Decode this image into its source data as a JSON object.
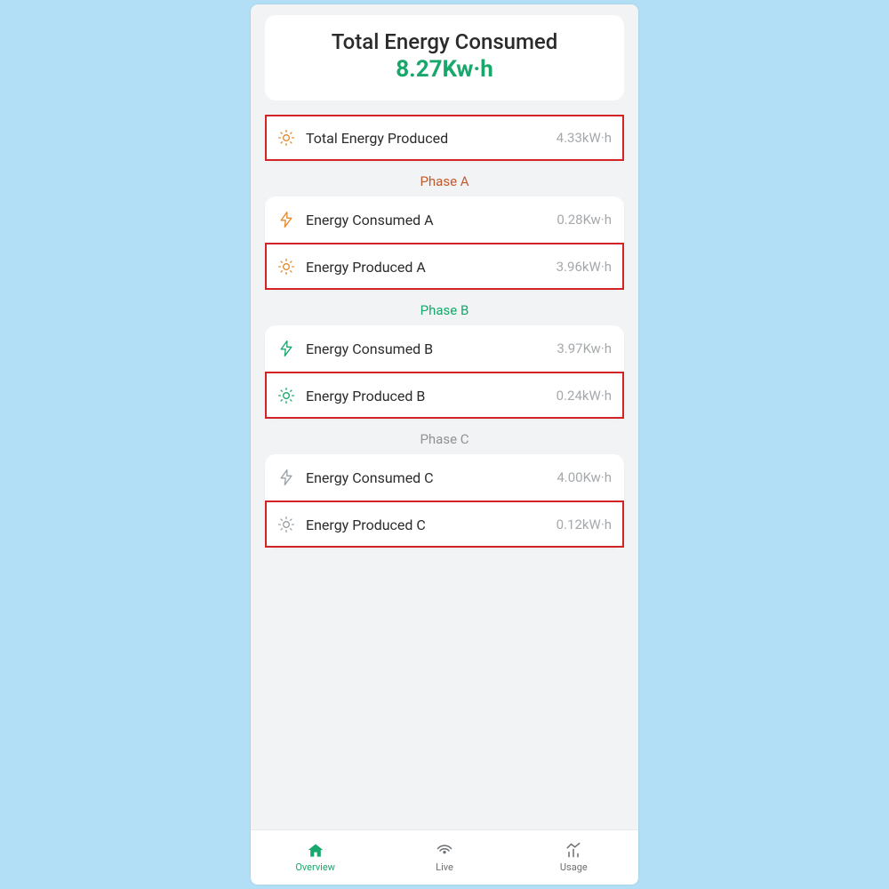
{
  "header": {
    "title": "Total Energy Consumed",
    "value": "8.27Kw·h"
  },
  "total_produced": {
    "label": "Total Energy Produced",
    "value": "4.33kW·h"
  },
  "phases": [
    {
      "title": "Phase A",
      "title_color": "orange",
      "consumed_label": "Energy Consumed A",
      "consumed_value": "0.28Kw·h",
      "consumed_icon_color": "orange",
      "produced_label": "Energy Produced A",
      "produced_value": "3.96kW·h",
      "produced_icon_color": "orange"
    },
    {
      "title": "Phase B",
      "title_color": "green",
      "consumed_label": "Energy Consumed B",
      "consumed_value": "3.97Kw·h",
      "consumed_icon_color": "green",
      "produced_label": "Energy Produced B",
      "produced_value": "0.24kW·h",
      "produced_icon_color": "green"
    },
    {
      "title": "Phase C",
      "title_color": "gray",
      "consumed_label": "Energy Consumed C",
      "consumed_value": "4.00Kw·h",
      "consumed_icon_color": "gray",
      "produced_label": "Energy Produced C",
      "produced_value": "0.12kW·h",
      "produced_icon_color": "gray"
    }
  ],
  "nav": {
    "overview": "Overview",
    "live": "Live",
    "usage": "Usage"
  },
  "colors": {
    "orange": "#e38a2e",
    "green": "#18a86b",
    "gray": "#9aa0a4",
    "highlight": "#d22424"
  }
}
